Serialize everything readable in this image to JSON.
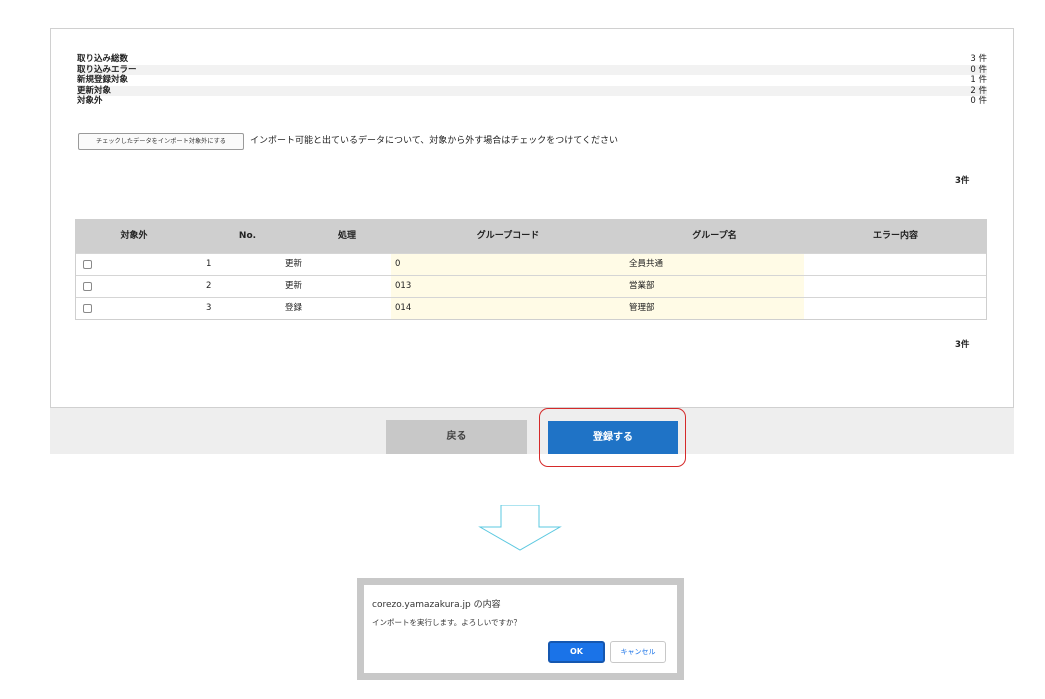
{
  "summary": {
    "rows": [
      {
        "label": "取り込み総数",
        "count": "3 件"
      },
      {
        "label": "取り込みエラー",
        "count": "0 件"
      },
      {
        "label": "新規登録対象",
        "count": "1 件"
      },
      {
        "label": "更新対象",
        "count": "2 件"
      },
      {
        "label": "対象外",
        "count": "0 件"
      }
    ]
  },
  "toolbar": {
    "exclude_button_label": "チェックしたデータをインポート対象外にする",
    "instruction": "インポート可能と出ているデータについて、対象から外す場合はチェックをつけてください"
  },
  "result_count_top": "3件",
  "result_count_bottom": "3件",
  "table": {
    "headers": [
      "対象外",
      "No.",
      "処理",
      "グループコード",
      "グループ名",
      "エラー内容"
    ],
    "rows": [
      {
        "checked": false,
        "no": "1",
        "action": "更新",
        "group_code": "0",
        "group_name": "全員共通",
        "error": ""
      },
      {
        "checked": false,
        "no": "2",
        "action": "更新",
        "group_code": "013",
        "group_name": "営業部",
        "error": ""
      },
      {
        "checked": false,
        "no": "3",
        "action": "登録",
        "group_code": "014",
        "group_name": "管理部",
        "error": ""
      }
    ]
  },
  "footer": {
    "back_label": "戻る",
    "register_label": "登録する"
  },
  "dialog": {
    "title": "corezo.yamazakura.jp の内容",
    "message": "インポートを実行します。よろしいですか？",
    "ok_label": "OK",
    "cancel_label": "キャンセル"
  },
  "colors": {
    "primary": "#1f73c6",
    "highlight": "#d52a2a",
    "cell_highlight": "#fffbe6",
    "arrow": "#5bc8e0"
  }
}
